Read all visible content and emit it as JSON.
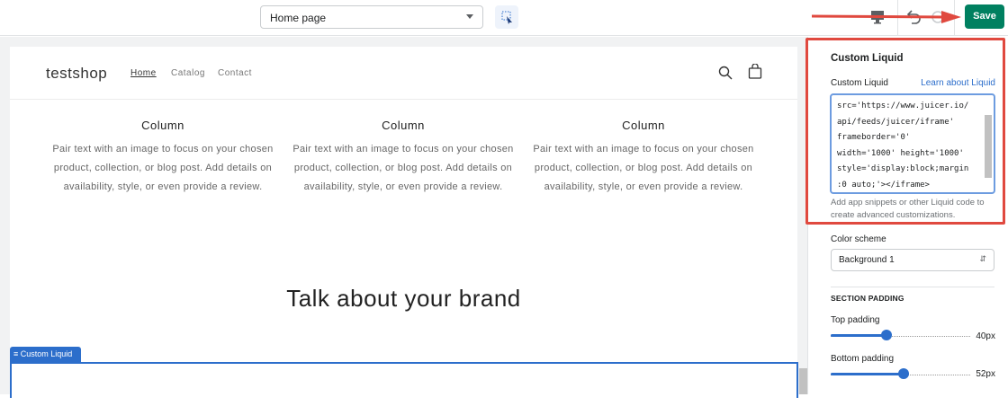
{
  "topbar": {
    "page_select": "Home page",
    "save_label": "Save"
  },
  "store": {
    "logo": "testshop",
    "nav": [
      "Home",
      "Catalog",
      "Contact"
    ],
    "columns": [
      {
        "title": "Column",
        "text": "Pair text with an image to focus on your chosen product, collection, or blog post. Add details on availability, style, or even provide a review."
      },
      {
        "title": "Column",
        "text": "Pair text with an image to focus on your chosen product, collection, or blog post. Add details on availability, style, or even provide a review."
      },
      {
        "title": "Column",
        "text": "Pair text with an image to focus on your chosen product, collection, or blog post. Add details on availability, style, or even provide a review."
      }
    ],
    "brand_heading": "Talk about your brand",
    "section_tag": "Custom Liquid"
  },
  "panel": {
    "title": "Custom Liquid",
    "field_label": "Custom Liquid",
    "learn_link": "Learn about Liquid",
    "code": "src='https://www.juicer.io/\napi/feeds/juicer/iframe'\nframeborder='0'\nwidth='1000' height='1000'\nstyle='display:block;margin\n:0 auto;'></iframe>",
    "help": "Add app snippets or other Liquid code to create advanced customizations.",
    "color_scheme_label": "Color scheme",
    "color_scheme_value": "Background 1",
    "section_padding": "SECTION PADDING",
    "top_padding_label": "Top padding",
    "top_padding_value": "40px",
    "top_padding_fraction": 0.4,
    "bottom_padding_label": "Bottom padding",
    "bottom_padding_value": "52px",
    "bottom_padding_fraction": 0.52
  },
  "colors": {
    "save": "#008060",
    "accent": "#2c6ecb",
    "annotation": "#e0493f"
  }
}
